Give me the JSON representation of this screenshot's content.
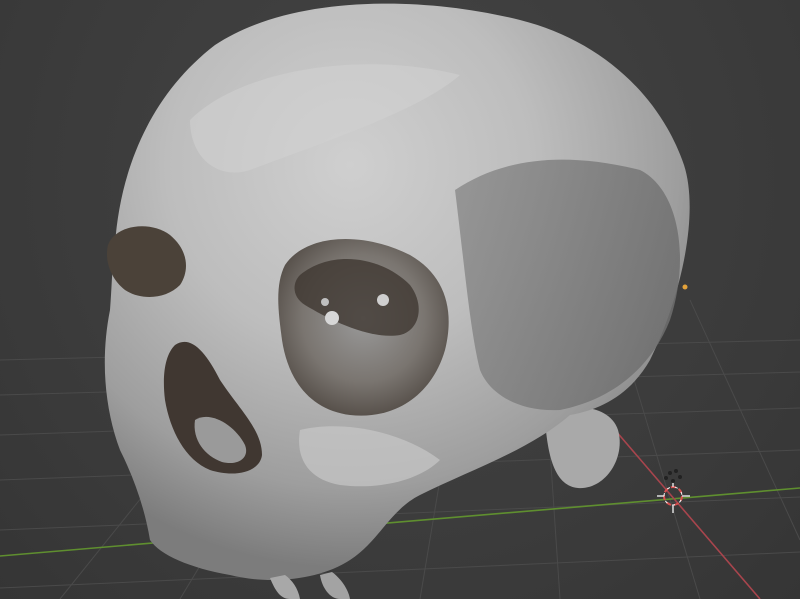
{
  "viewport": {
    "mode": "3D Viewport",
    "object": "skull-mesh",
    "grid_visible": true,
    "colors": {
      "background": "#3d3d3d",
      "grid": "#4a4a4a",
      "x_axis": "#a8454d",
      "y_axis": "#5f8f2f",
      "mesh": "#b8b8b8",
      "mesh_shadow": "#5a5048",
      "light": "#e3a23a",
      "cursor_ring": "#d94f4f"
    }
  },
  "gizmos": {
    "light_icon": "light-icon",
    "cursor_icon": "3d-cursor-icon",
    "origin_icon": "origin-icon"
  }
}
